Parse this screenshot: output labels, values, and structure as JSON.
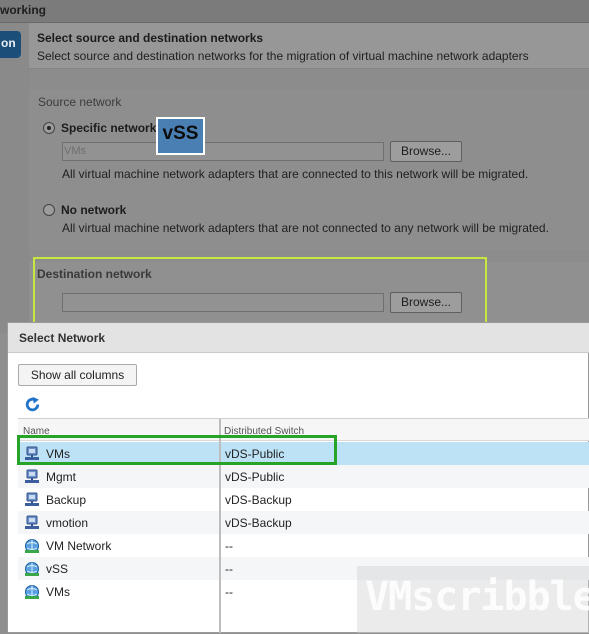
{
  "window": {
    "title": "working"
  },
  "step_nav": {
    "active_label": "on"
  },
  "page": {
    "title": "Select source and destination networks",
    "subtitle": "Select source and destination networks for the migration of virtual machine network adapters"
  },
  "source": {
    "section_label": "Source network",
    "specific_label": "Specific network",
    "specific_value": "VMs",
    "specific_description": "All virtual machine network adapters that are connected to this network will be migrated.",
    "none_label": "No network",
    "none_description": "All virtual machine network adapters that are not connected to any network will be migrated.",
    "browse_label": "Browse...",
    "selected_option": "Specific network"
  },
  "destination": {
    "section_label": "Destination network",
    "value": "",
    "browse_label": "Browse..."
  },
  "annotation": {
    "badge_text": "vSS"
  },
  "dialog": {
    "title": "Select Network",
    "show_all_label": "Show all columns",
    "columns": [
      "Name",
      "Distributed Switch"
    ],
    "rows": [
      {
        "name": "VMs",
        "switch": "vDS-Public",
        "icon": "distributed-portgroup-icon",
        "selected": true
      },
      {
        "name": "Mgmt",
        "switch": "vDS-Public",
        "icon": "distributed-portgroup-icon"
      },
      {
        "name": "Backup",
        "switch": "vDS-Backup",
        "icon": "distributed-portgroup-icon"
      },
      {
        "name": "vmotion",
        "switch": "vDS-Backup",
        "icon": "distributed-portgroup-icon"
      },
      {
        "name": "VM Network",
        "switch": "--",
        "icon": "standard-network-icon"
      },
      {
        "name": "vSS",
        "switch": "--",
        "icon": "standard-network-icon"
      },
      {
        "name": "VMs",
        "switch": "--",
        "icon": "standard-network-icon"
      }
    ]
  },
  "watermark": {
    "text": "VMscribble"
  },
  "colors": {
    "selection": "#bde2f5",
    "dest_highlight": "#c6e83c",
    "row_highlight": "#27a327",
    "badge": "#4a7fb4"
  }
}
